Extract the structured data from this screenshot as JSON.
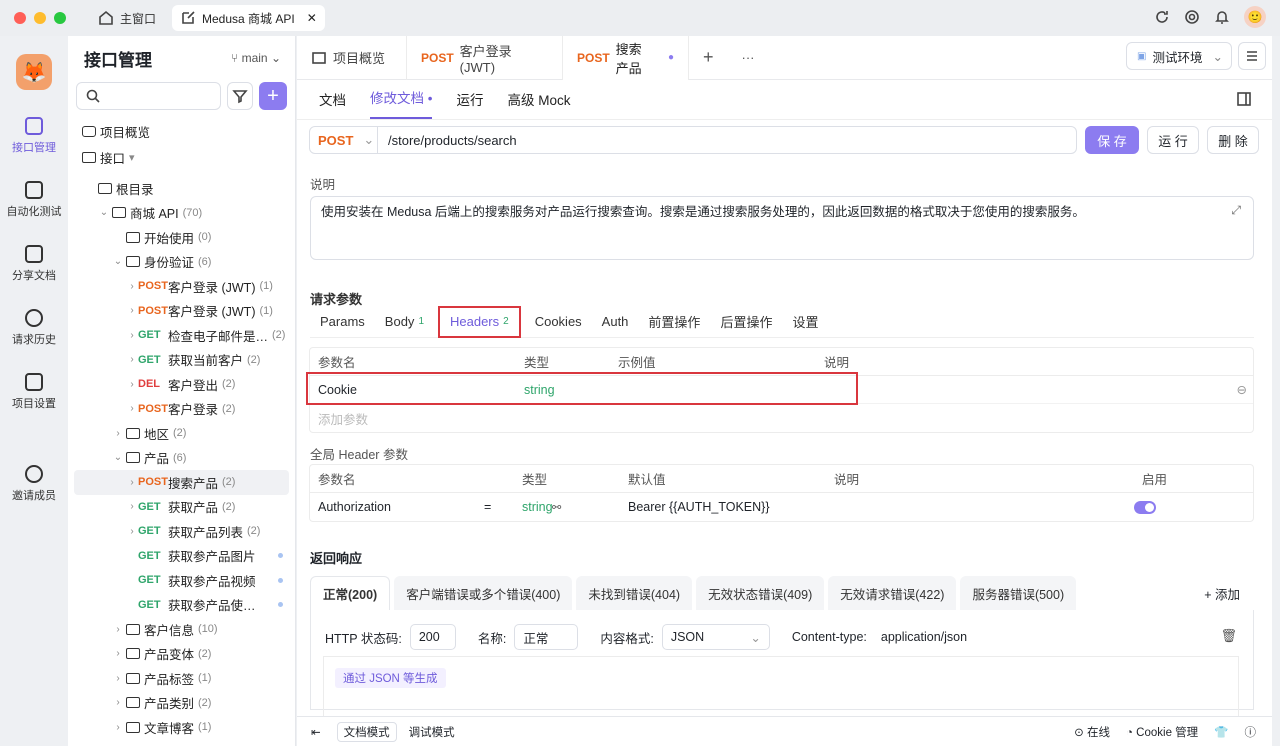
{
  "window": {
    "home_tab": "主窗口",
    "app_tab": "Medusa 商城 API"
  },
  "rail": [
    {
      "label": "接口管理",
      "active": true
    },
    {
      "label": "自动化测试"
    },
    {
      "label": "分享文档"
    },
    {
      "label": "请求历史"
    },
    {
      "label": "项目设置"
    },
    {
      "label": "邀请成员"
    }
  ],
  "tree": {
    "title": "接口管理",
    "branch": "main",
    "overview": "项目概览",
    "api_label": "接口",
    "rows": [
      {
        "type": "folder",
        "label": "根目录",
        "indent": 0,
        "caret": ""
      },
      {
        "type": "folder",
        "label": "商城 API",
        "count": "(70)",
        "indent": 1,
        "caret": "⌄"
      },
      {
        "type": "folder",
        "label": "开始使用",
        "count": "(0)",
        "indent": 2,
        "caret": ""
      },
      {
        "type": "folder",
        "label": "身份验证",
        "count": "(6)",
        "indent": 2,
        "caret": "⌄"
      },
      {
        "type": "api",
        "method": "POST",
        "label": "客户登录 (JWT)",
        "count": "(1)",
        "indent": 3
      },
      {
        "type": "api",
        "method": "POST",
        "label": "客户登录 (JWT)",
        "count": "(1)",
        "indent": 3
      },
      {
        "type": "api",
        "method": "GET",
        "label": "检查电子邮件是…",
        "count": "(2)",
        "indent": 3
      },
      {
        "type": "api",
        "method": "GET",
        "label": "获取当前客户",
        "count": "(2)",
        "indent": 3
      },
      {
        "type": "api",
        "method": "DEL",
        "label": "客户登出",
        "count": "(2)",
        "indent": 3
      },
      {
        "type": "api",
        "method": "POST",
        "label": "客户登录",
        "count": "(2)",
        "indent": 3
      },
      {
        "type": "folder",
        "label": "地区",
        "count": "(2)",
        "indent": 2,
        "caret": "›"
      },
      {
        "type": "folder",
        "label": "产品",
        "count": "(6)",
        "indent": 2,
        "caret": "⌄"
      },
      {
        "type": "api",
        "method": "POST",
        "label": "搜索产品",
        "count": "(2)",
        "indent": 3,
        "selected": true
      },
      {
        "type": "api",
        "method": "GET",
        "label": "获取产品",
        "count": "(2)",
        "indent": 3
      },
      {
        "type": "api",
        "method": "GET",
        "label": "获取产品列表",
        "count": "(2)",
        "indent": 3
      },
      {
        "type": "api",
        "method": "GET",
        "label": "获取参产品图片",
        "count": "",
        "indent": 3,
        "dot": true
      },
      {
        "type": "api",
        "method": "GET",
        "label": "获取参产品视频",
        "count": "",
        "indent": 3,
        "dot": true
      },
      {
        "type": "api",
        "method": "GET",
        "label": "获取参产品使…",
        "count": "",
        "indent": 3,
        "dot": true
      },
      {
        "type": "folder",
        "label": "客户信息",
        "count": "(10)",
        "indent": 2,
        "caret": "›"
      },
      {
        "type": "folder",
        "label": "产品变体",
        "count": "(2)",
        "indent": 2,
        "caret": "›"
      },
      {
        "type": "folder",
        "label": "产品标签",
        "count": "(1)",
        "indent": 2,
        "caret": "›"
      },
      {
        "type": "folder",
        "label": "产品类别",
        "count": "(2)",
        "indent": 2,
        "caret": "›"
      },
      {
        "type": "folder",
        "label": "文章博客",
        "count": "(1)",
        "indent": 2,
        "caret": "›"
      }
    ]
  },
  "tabs": {
    "overview": "项目概览",
    "t1_method": "POST",
    "t1_label": "客户登录 (JWT)",
    "t2_method": "POST",
    "t2_label": "搜索产品",
    "env": "测试环境"
  },
  "subtabs": [
    "文档",
    "修改文档 •",
    "运行",
    "高级 Mock"
  ],
  "request": {
    "method": "POST",
    "url": "/store/products/search",
    "save": "保 存",
    "run": "运 行",
    "delete": "删 除",
    "desc_label": "说明",
    "description": "使用安装在 Medusa 后端上的搜索服务对产品运行搜索查询。搜索是通过搜索服务处理的，因此返回数据的格式取决于您使用的搜索服务。",
    "params_title": "请求参数"
  },
  "param_tabs": [
    {
      "label": "Params"
    },
    {
      "label": "Body",
      "n": "1"
    },
    {
      "label": "Headers",
      "n": "2",
      "active": true
    },
    {
      "label": "Cookies"
    },
    {
      "label": "Auth"
    },
    {
      "label": "前置操作"
    },
    {
      "label": "后置操作"
    },
    {
      "label": "设置"
    }
  ],
  "headers_table": {
    "cols": [
      "参数名",
      "类型",
      "示例值",
      "说明"
    ],
    "row": {
      "name": "Cookie",
      "type": "string"
    },
    "add": "添加参数"
  },
  "global": {
    "title": "全局 Header 参数",
    "cols": [
      "参数名",
      "类型",
      "默认值",
      "说明",
      "启用"
    ],
    "row": {
      "name": "Authorization",
      "eq": "=",
      "type": "string",
      "default": "Bearer {{AUTH_TOKEN}}"
    }
  },
  "response": {
    "title": "返回响应",
    "tabs": [
      "正常(200)",
      "客户端错误或多个错误(400)",
      "未找到错误(404)",
      "无效状态错误(409)",
      "无效请求错误(422)",
      "服务器错误(500)"
    ],
    "add": "+ 添加",
    "status_label": "HTTP 状态码:",
    "status": "200",
    "name_label": "名称:",
    "name": "正常",
    "format_label": "内容格式:",
    "format": "JSON",
    "ct_label": "Content-type:",
    "ct": "application/json",
    "gen": "通过 JSON 等生成"
  },
  "footer": {
    "doc_mode": "文档模式",
    "debug_mode": "调试模式",
    "online": "在线",
    "cookie": "Cookie 管理"
  }
}
